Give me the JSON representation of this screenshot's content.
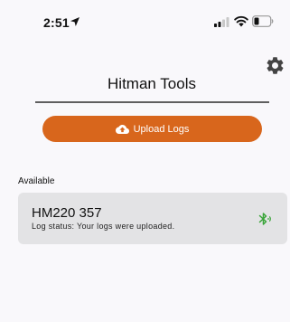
{
  "status_bar": {
    "time": "2:51"
  },
  "header": {
    "title": "Hitman Tools"
  },
  "actions": {
    "upload_label": "Upload Logs"
  },
  "devices": {
    "section_label": "Available",
    "items": [
      {
        "name": "HM220 357",
        "status": "Log status: Your logs were uploaded."
      }
    ]
  },
  "colors": {
    "accent": "#d8661c",
    "bluetooth": "#3aa53a",
    "card_background": "#e3e3e5"
  },
  "icons": {
    "settings": "gear-icon",
    "upload": "cloud-upload-icon",
    "device_connection": "bluetooth-icon"
  }
}
